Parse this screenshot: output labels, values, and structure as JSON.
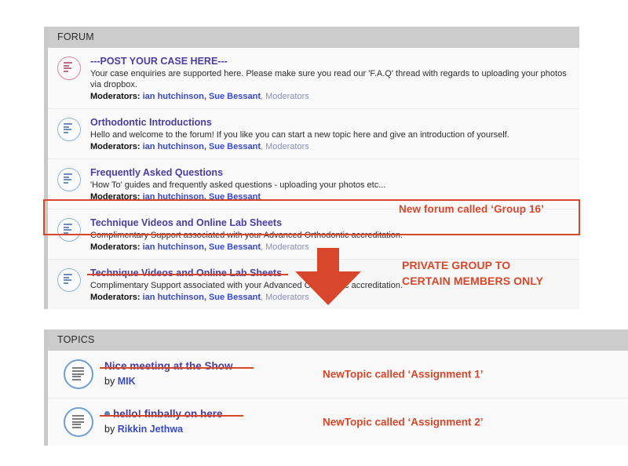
{
  "forum": {
    "header": "FORUM",
    "rows": [
      {
        "icon": "forum-unread-red-icon",
        "title": "---POST YOUR CASE HERE---",
        "desc": "Your case enquiries are supported here. Please make sure you read our 'F.A.Q' thread with regards to uploading your photos via dropbox.",
        "mods_label": "Moderators:",
        "mods_links": "ian hutchinson, Sue Bessant",
        "mods_group": ", Moderators",
        "struck": false
      },
      {
        "icon": "forum-icon",
        "title": "Orthodontic Introductions",
        "desc": "Hello and welcome to the forum! If you like you can start a new topic here and give an introduction of yourself.",
        "mods_label": "Moderators:",
        "mods_links": "ian hutchinson, Sue Bessant",
        "mods_group": ", Moderators",
        "struck": false
      },
      {
        "icon": "forum-icon",
        "title": "Frequently Asked Questions",
        "desc": "'How To' guides and frequently asked questions - uploading your photos etc...",
        "mods_label": "Moderators:",
        "mods_links": "ian hutchinson, Sue Bessant",
        "mods_group": "",
        "struck": false
      },
      {
        "icon": "forum-icon",
        "title": "Technique Videos and Online Lab Sheets",
        "desc": "Complimentary Support associated with your Advanced Orthodontic accreditation.",
        "mods_label": "Moderators:",
        "mods_links": "ian hutchinson, Sue Bessant",
        "mods_group": ", Moderators",
        "struck": false
      },
      {
        "icon": "forum-icon",
        "title": "Technique Videos and Online Lab Sheets",
        "desc": "Complimentary Support associated with your Advanced Orthodontic accreditation.",
        "mods_label": "Moderators:",
        "mods_links": "ian hutchinson, Sue Bessant",
        "mods_group": ", Moderators",
        "struck": true
      }
    ]
  },
  "annotations": {
    "new_forum": "New forum called ‘Group 16’",
    "private_line1": "PRIVATE GROUP TO",
    "private_line2": "CERTAIN MEMBERS ONLY",
    "arrow": "down-arrow-icon",
    "color": "#d8472b"
  },
  "topics": {
    "header": "TOPICS",
    "rows": [
      {
        "icon": "topic-icon",
        "has_dot": false,
        "title": "Nice meeting at the Show",
        "by_prefix": "by ",
        "author": "MIK",
        "annotation": "NewTopic called ‘Assignment 1’",
        "struck": true
      },
      {
        "icon": "topic-icon",
        "has_dot": true,
        "title": "hello! finbally on here",
        "by_prefix": "by ",
        "author": "Rikkin Jethwa",
        "annotation": "NewTopic called ‘Assignment 2’",
        "struck": true
      }
    ]
  }
}
